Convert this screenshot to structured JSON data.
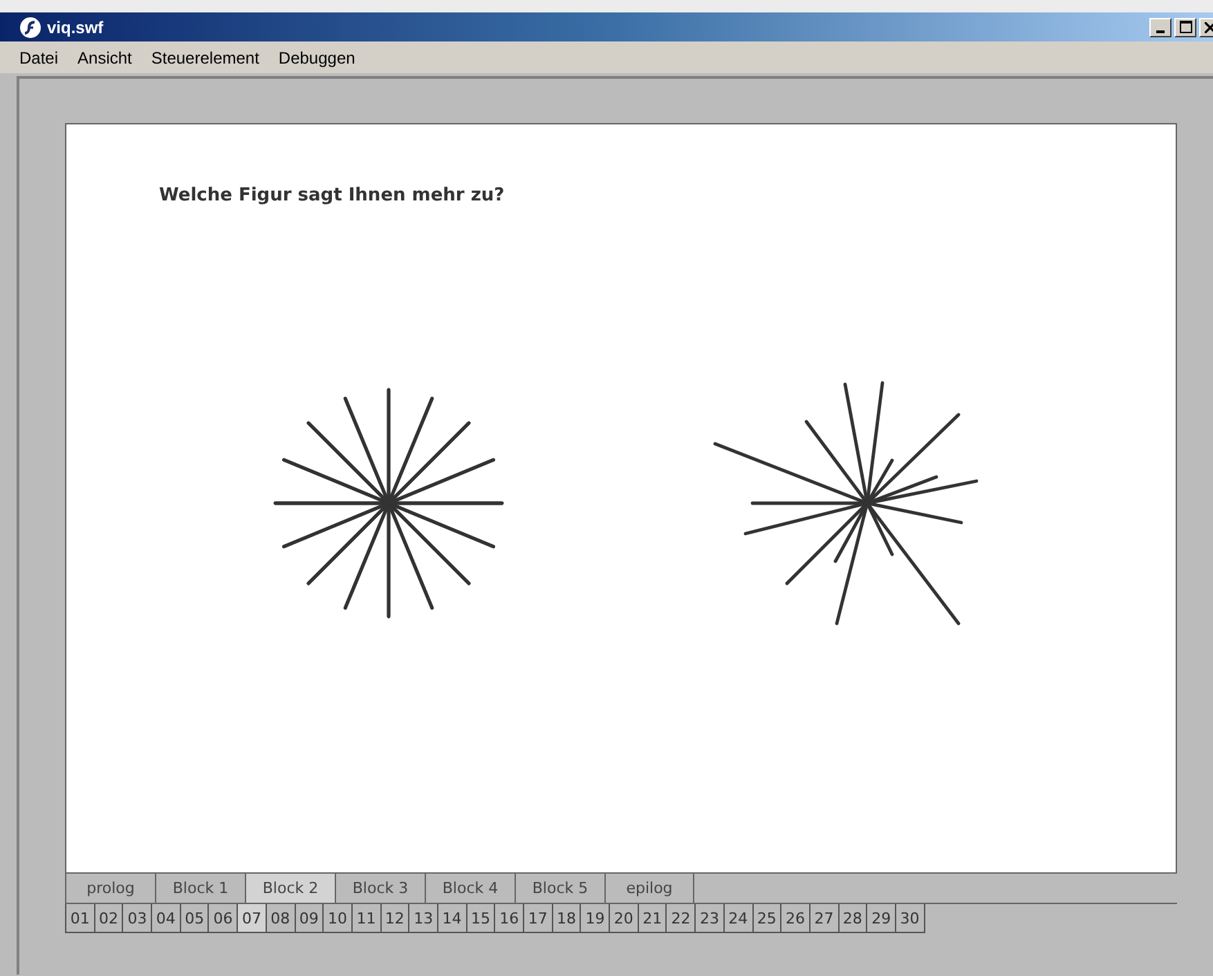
{
  "window": {
    "title": "viq.swf"
  },
  "menu": [
    "Datei",
    "Ansicht",
    "Steuerelement",
    "Debuggen"
  ],
  "question": "Welche Figur sagt Ihnen mehr zu?",
  "blocks": [
    {
      "label": "prolog",
      "selected": false
    },
    {
      "label": "Block 1",
      "selected": false
    },
    {
      "label": "Block 2",
      "selected": true
    },
    {
      "label": "Block 3",
      "selected": false
    },
    {
      "label": "Block 4",
      "selected": false
    },
    {
      "label": "Block 5",
      "selected": false
    },
    {
      "label": "epilog",
      "selected": false
    }
  ],
  "pages": [
    {
      "label": "01",
      "selected": false
    },
    {
      "label": "02",
      "selected": false
    },
    {
      "label": "03",
      "selected": false
    },
    {
      "label": "04",
      "selected": false
    },
    {
      "label": "05",
      "selected": false
    },
    {
      "label": "06",
      "selected": false
    },
    {
      "label": "07",
      "selected": true
    },
    {
      "label": "08",
      "selected": false
    },
    {
      "label": "09",
      "selected": false
    },
    {
      "label": "10",
      "selected": false
    },
    {
      "label": "11",
      "selected": false
    },
    {
      "label": "12",
      "selected": false
    },
    {
      "label": "13",
      "selected": false
    },
    {
      "label": "14",
      "selected": false
    },
    {
      "label": "15",
      "selected": false
    },
    {
      "label": "16",
      "selected": false
    },
    {
      "label": "17",
      "selected": false
    },
    {
      "label": "18",
      "selected": false
    },
    {
      "label": "19",
      "selected": false
    },
    {
      "label": "20",
      "selected": false
    },
    {
      "label": "21",
      "selected": false
    },
    {
      "label": "22",
      "selected": false
    },
    {
      "label": "23",
      "selected": false
    },
    {
      "label": "24",
      "selected": false
    },
    {
      "label": "25",
      "selected": false
    },
    {
      "label": "26",
      "selected": false
    },
    {
      "label": "27",
      "selected": false
    },
    {
      "label": "28",
      "selected": false
    },
    {
      "label": "29",
      "selected": false
    },
    {
      "label": "30",
      "selected": false
    }
  ]
}
